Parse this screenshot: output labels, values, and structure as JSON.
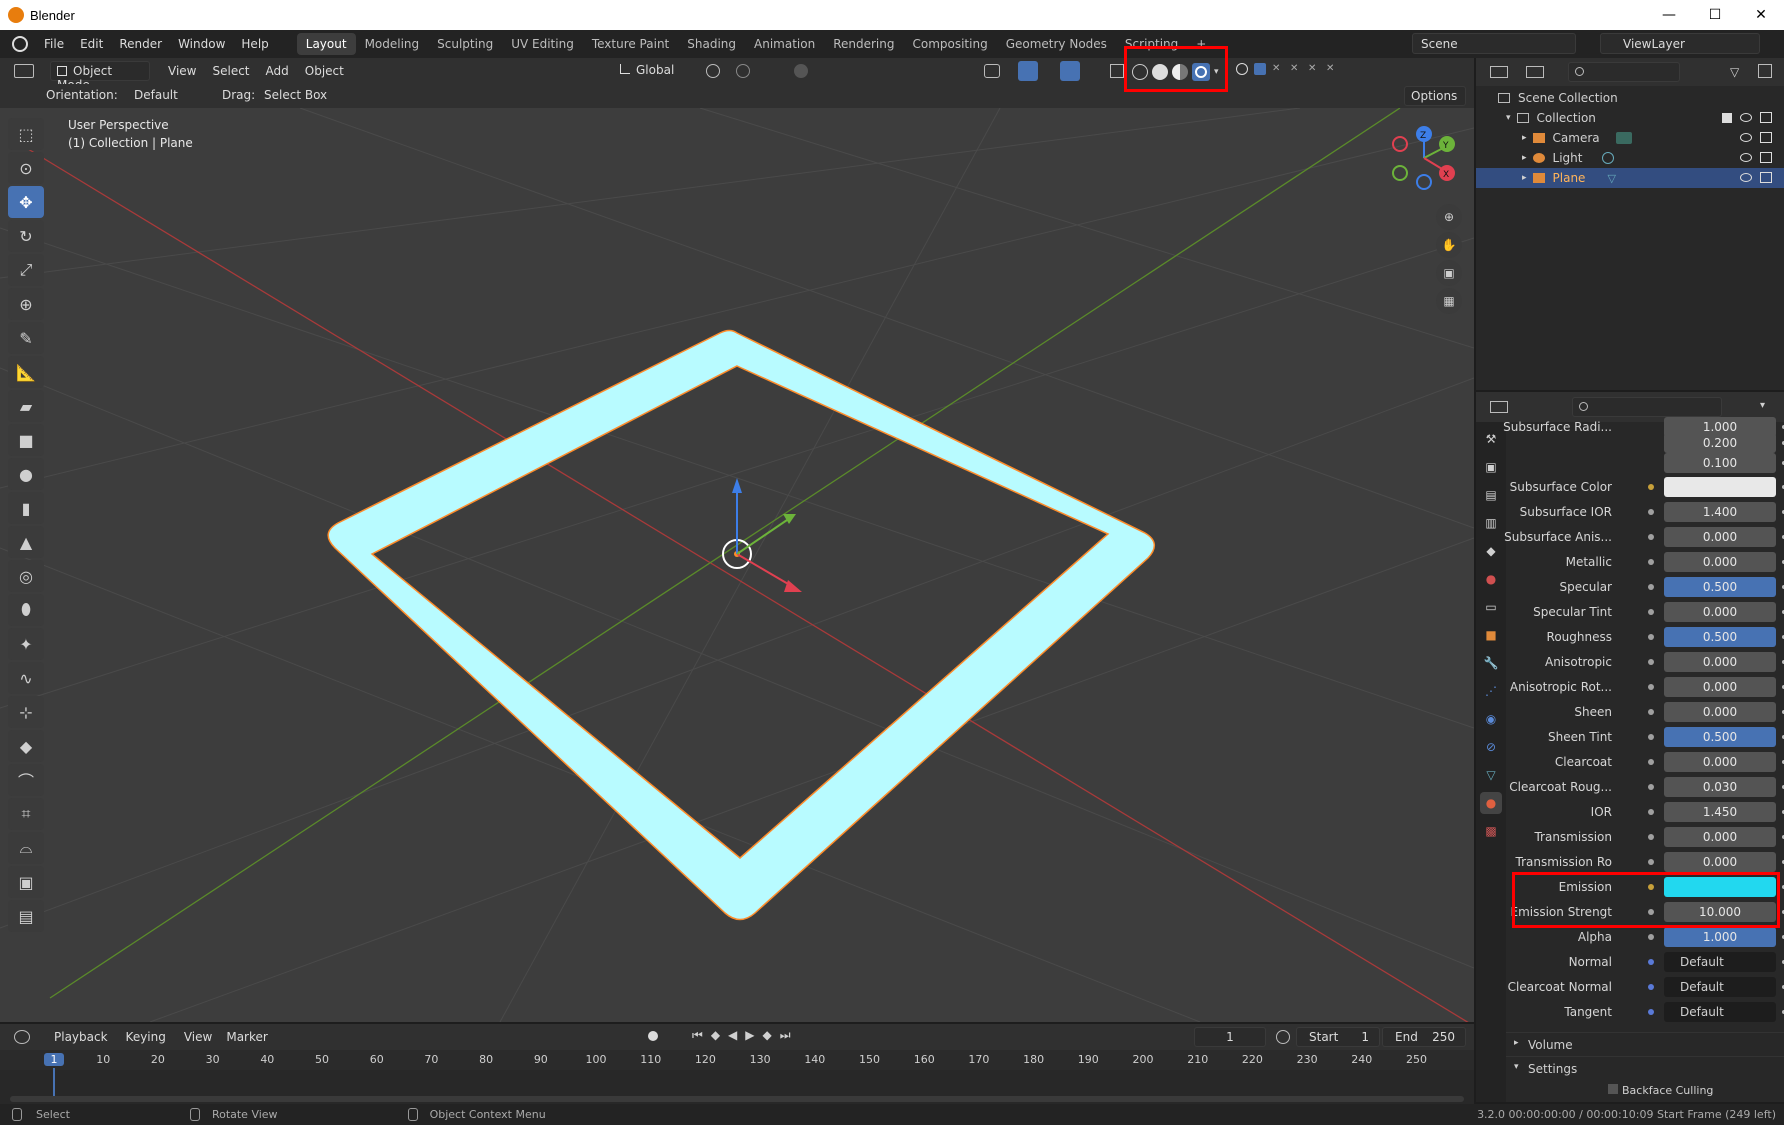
{
  "app": {
    "title": "Blender",
    "version_status": "3.2.0   00:00:00:00 / 00:00:10:09   Start Frame (249 left)"
  },
  "window_controls": {
    "minimize": "—",
    "maximize": "☐",
    "close": "✕"
  },
  "menus": [
    "File",
    "Edit",
    "Render",
    "Window",
    "Help"
  ],
  "workspaces": [
    "Layout",
    "Modeling",
    "Sculpting",
    "UV Editing",
    "Texture Paint",
    "Shading",
    "Animation",
    "Rendering",
    "Compositing",
    "Geometry Nodes",
    "Scripting",
    "+"
  ],
  "active_workspace": "Layout",
  "scene": {
    "scene_name": "Scene",
    "view_layer": "ViewLayer"
  },
  "viewport_header": {
    "mode": "Object Mode",
    "menus": [
      "View",
      "Select",
      "Add",
      "Object"
    ],
    "transform_orientation": "Global",
    "orientation_label": "Orientation:",
    "orientation_value": "Default",
    "drag_label": "Drag:",
    "drag_value": "Select Box",
    "options": "Options"
  },
  "viewport": {
    "perspective": "User Perspective",
    "context": "(1) Collection | Plane"
  },
  "gizmo": {
    "x": "X",
    "y": "Y",
    "z": "Z"
  },
  "outliner": {
    "root": "Scene Collection",
    "items": [
      {
        "name": "Collection",
        "depth": 1
      },
      {
        "name": "Camera",
        "depth": 2
      },
      {
        "name": "Light",
        "depth": 2
      },
      {
        "name": "Plane",
        "depth": 2,
        "selected": true
      }
    ]
  },
  "properties": {
    "rows": [
      {
        "label": "Subsurface Radi...",
        "value": "1.000",
        "style": "normal"
      },
      {
        "label": "",
        "value": "0.200",
        "style": "normal"
      },
      {
        "label": "",
        "value": "0.100",
        "style": "normal"
      },
      {
        "label": "Subsurface Color",
        "value": "",
        "style": "color-white"
      },
      {
        "label": "Subsurface IOR",
        "value": "1.400",
        "style": "normal"
      },
      {
        "label": "Subsurface Anis...",
        "value": "0.000",
        "style": "normal"
      },
      {
        "label": "Metallic",
        "value": "0.000",
        "style": "normal"
      },
      {
        "label": "Specular",
        "value": "0.500",
        "style": "blue"
      },
      {
        "label": "Specular Tint",
        "value": "0.000",
        "style": "normal"
      },
      {
        "label": "Roughness",
        "value": "0.500",
        "style": "blue"
      },
      {
        "label": "Anisotropic",
        "value": "0.000",
        "style": "normal"
      },
      {
        "label": "Anisotropic Rot...",
        "value": "0.000",
        "style": "normal"
      },
      {
        "label": "Sheen",
        "value": "0.000",
        "style": "normal"
      },
      {
        "label": "Sheen Tint",
        "value": "0.500",
        "style": "blue"
      },
      {
        "label": "Clearcoat",
        "value": "0.000",
        "style": "normal"
      },
      {
        "label": "Clearcoat Roug...",
        "value": "0.030",
        "style": "normal"
      },
      {
        "label": "IOR",
        "value": "1.450",
        "style": "normal"
      },
      {
        "label": "Transmission",
        "value": "0.000",
        "style": "normal"
      },
      {
        "label": "Transmission Ro",
        "value": "0.000",
        "style": "normal"
      },
      {
        "label": "Emission",
        "value": "",
        "style": "color-cyan"
      },
      {
        "label": "Emission Strengt",
        "value": "10.000",
        "style": "normal"
      },
      {
        "label": "Alpha",
        "value": "1.000",
        "style": "blue"
      },
      {
        "label": "Normal",
        "value": "Default",
        "style": "dark"
      },
      {
        "label": "Clearcoat Normal",
        "value": "Default",
        "style": "dark"
      },
      {
        "label": "Tangent",
        "value": "Default",
        "style": "dark"
      }
    ],
    "panels": [
      "Volume",
      "Settings"
    ],
    "settings_first": "Backface Culling"
  },
  "timeline": {
    "menus": [
      "Playback",
      "Keying",
      "View",
      "Marker"
    ],
    "current_frame": "1",
    "start_label": "Start",
    "start": "1",
    "end_label": "End",
    "end": "250",
    "ticks": [
      "1",
      "10",
      "20",
      "30",
      "40",
      "50",
      "60",
      "70",
      "80",
      "90",
      "100",
      "110",
      "120",
      "130",
      "140",
      "150",
      "160",
      "170",
      "180",
      "190",
      "200",
      "210",
      "220",
      "230",
      "240",
      "250"
    ]
  },
  "statusbar": {
    "select": "Select",
    "rotate": "Rotate View",
    "context_menu": "Object Context Menu"
  },
  "colors": {
    "emission": "#22d8ef",
    "plane_glow": "#b3ffff",
    "selection_outline": "#ff8c2a",
    "accent": "#4772b3",
    "highlight_box": "#ff0000"
  }
}
